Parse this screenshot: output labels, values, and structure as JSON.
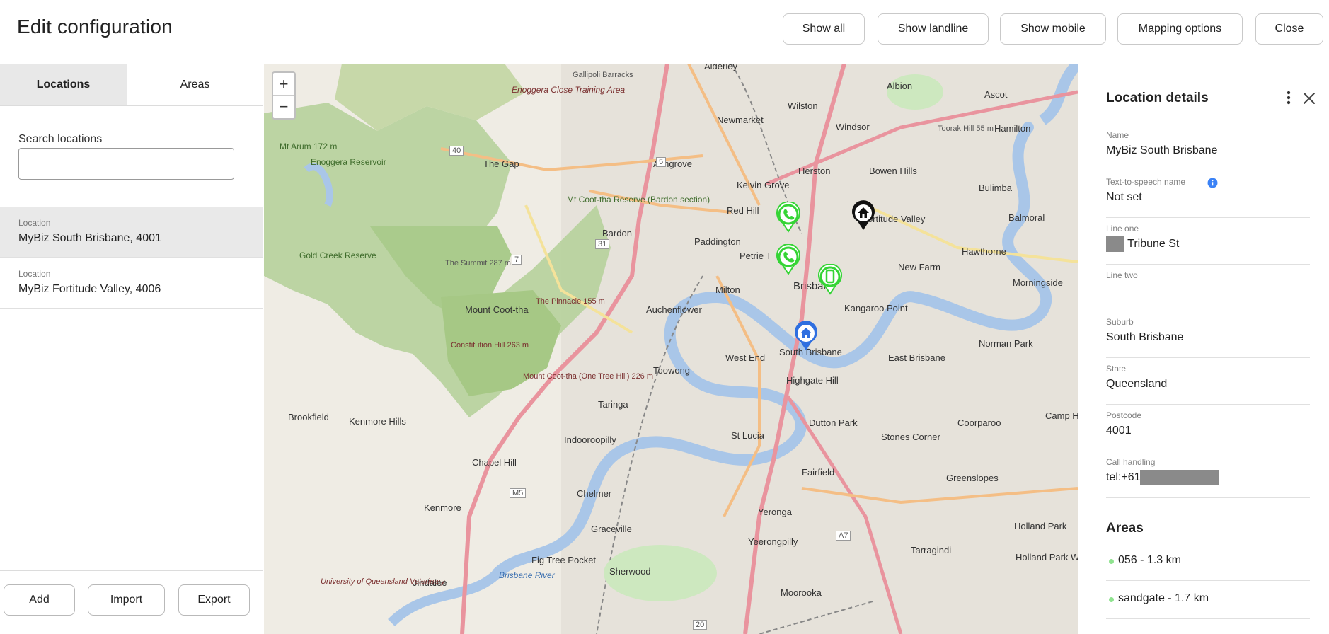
{
  "header": {
    "title": "Edit configuration",
    "buttons": {
      "show_all": "Show all",
      "show_landline": "Show landline",
      "show_mobile": "Show mobile",
      "mapping_options": "Mapping options",
      "close": "Close"
    }
  },
  "left_panel": {
    "tabs": [
      {
        "label": "Locations",
        "active": true
      },
      {
        "label": "Areas",
        "active": false
      }
    ],
    "search": {
      "label": "Search locations",
      "value": "",
      "placeholder": ""
    },
    "locations": [
      {
        "label": "Location",
        "value": "MyBiz South Brisbane, 4001",
        "selected": true
      },
      {
        "label": "Location",
        "value": "MyBiz Fortitude Valley, 4006",
        "selected": false
      }
    ],
    "footer_buttons": {
      "add": "Add",
      "import": "Import",
      "export": "Export"
    }
  },
  "map": {
    "zoom_in": "+",
    "zoom_out": "−",
    "labels": {
      "enoggera": "Enoggera Close Training Area",
      "gallipoli": "Gallipoli Barracks",
      "alderley": "Alderley",
      "albion": "Albion",
      "ascot": "Ascot",
      "wilston": "Wilston",
      "windsor": "Windsor",
      "newmarket": "Newmarket",
      "toorak": "Toorak Hill 55 m",
      "hamilton": "Hamilton",
      "mt_arum": "Mt Arum 172 m",
      "enoggera_res": "Enoggera Reservoir",
      "the_gap": "The Gap",
      "ashgrove": "Ashgrove",
      "herston": "Herston",
      "bowen_hills": "Bowen Hills",
      "bulimba": "Bulimba",
      "kelvin_grove": "Kelvin Grove",
      "mt_cootha_res": "Mt Coot-tha Reserve (Bardon section)",
      "red_hill": "Red Hill",
      "fortitude_valley": "Fortitude Valley",
      "balmoral": "Balmoral",
      "bardon": "Bardon",
      "paddington": "Paddington",
      "hawthorne": "Hawthorne",
      "petrie_terrace": "Petrie T",
      "new_farm": "New Farm",
      "gold_creek": "Gold Creek Reserve",
      "the_summit": "The Summit 287 m",
      "brisbane": "Brisbane",
      "morningside": "Morningside",
      "milton": "Milton",
      "kangaroo_point": "Kangaroo Point",
      "mount_cootha": "Mount Coot-tha",
      "the_pinnacle": "The Pinnacle 155 m",
      "auchenflower": "Auchenflower",
      "south_brisbane": "South Brisbane",
      "norman_park": "Norman Park",
      "constitution_hill": "Constitution Hill 263 m",
      "west_end": "West End",
      "east_brisbane": "East Brisbane",
      "toowong": "Toowong",
      "highgate_hill": "Highgate Hill",
      "one_tree_hill": "Mount Coot-tha (One Tree Hill) 226 m",
      "taringa": "Taringa",
      "brookfield": "Brookfield",
      "kenmore_hills": "Kenmore Hills",
      "dutton_park": "Dutton Park",
      "coorparoo": "Coorparoo",
      "camp_hill": "Camp Hi",
      "indooroopilly": "Indooroopilly",
      "st_lucia": "St Lucia",
      "stones_corner": "Stones Corner",
      "chapel_hill": "Chapel Hill",
      "fairfield": "Fairfield",
      "greenslopes": "Greenslopes",
      "kenmore": "Kenmore",
      "chelmer": "Chelmer",
      "yeronga": "Yeronga",
      "graceville": "Graceville",
      "holland_park": "Holland Park",
      "yeerongpilly": "Yeerongpilly",
      "tarragindi": "Tarragindi",
      "fig_tree_pocket": "Fig Tree Pocket",
      "holland_park_west": "Holland Park West",
      "jindalee": "Jindalee",
      "sherwood": "Sherwood",
      "moorooka": "Moorooka",
      "brisbane_river": "Brisbane River",
      "uq": "University of Queensland Veterinary",
      "m5": "M5",
      "r40": "40",
      "r5": "5",
      "r31": "31",
      "r7": "7",
      "r20": "20",
      "a7": "A7"
    },
    "markers": [
      {
        "name": "landline-marker-red-hill",
        "type": "landline",
        "color": "#35d435"
      },
      {
        "name": "landline-marker-petrie-terrace",
        "type": "landline",
        "color": "#35d435"
      },
      {
        "name": "mobile-marker-brisbane",
        "type": "mobile",
        "color": "#35d435"
      },
      {
        "name": "location-marker-fortitude-valley",
        "type": "home",
        "color": "#111111"
      },
      {
        "name": "location-marker-south-brisbane",
        "type": "home",
        "color": "#2f6fe0"
      }
    ]
  },
  "details": {
    "title": "Location details",
    "fields": {
      "name": {
        "label": "Name",
        "value": "MyBiz South Brisbane"
      },
      "tts": {
        "label": "Text-to-speech name",
        "value": "Not set"
      },
      "line_one": {
        "label": "Line one",
        "value": "Tribune St"
      },
      "line_two": {
        "label": "Line two",
        "value": ""
      },
      "suburb": {
        "label": "Suburb",
        "value": "South Brisbane"
      },
      "state": {
        "label": "State",
        "value": "Queensland"
      },
      "postcode": {
        "label": "Postcode",
        "value": "4001"
      },
      "call_handling": {
        "label": "Call handling",
        "value": "tel:+61"
      }
    },
    "areas_title": "Areas",
    "areas": [
      {
        "label": "056 - 1.3 km"
      },
      {
        "label": "sandgate - 1.7 km"
      }
    ]
  },
  "colors": {
    "marker_green": "#35d435",
    "marker_blue": "#2f6fe0",
    "marker_black": "#111111",
    "area_dot": "#8fe38f",
    "info_blue": "#3b82f6"
  }
}
